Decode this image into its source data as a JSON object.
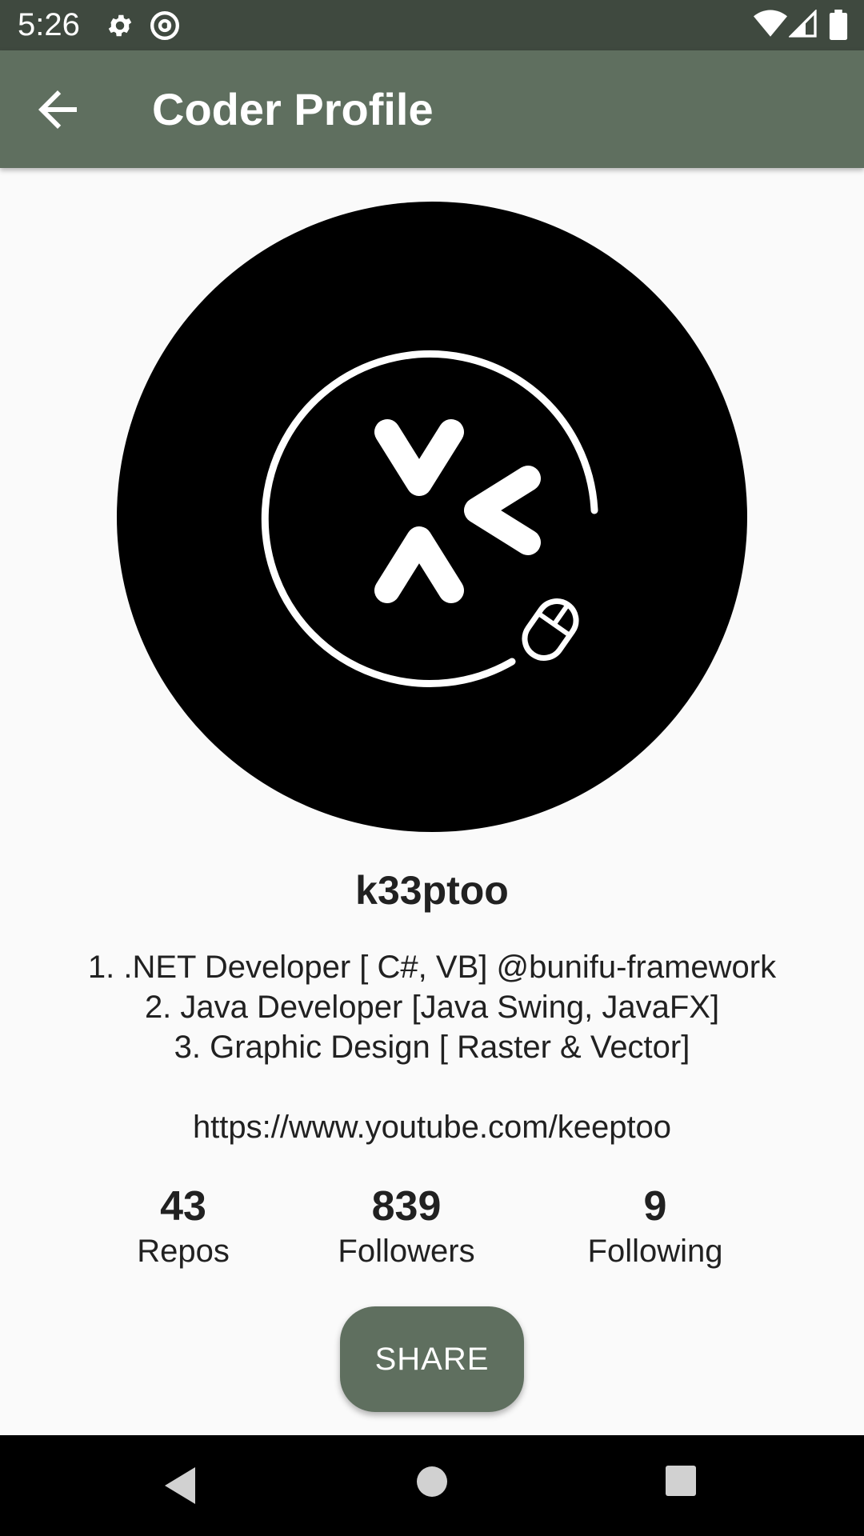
{
  "status_bar": {
    "time": "5:26",
    "icons": [
      "gear-icon",
      "at-sign-icon",
      "wifi-icon",
      "cell-signal-icon",
      "battery-icon"
    ]
  },
  "app_bar": {
    "title": "Coder Profile",
    "back_icon": "arrow-back-icon",
    "color": "#5f6f5f"
  },
  "profile": {
    "avatar_icon": "logo-avatar",
    "username": "k33ptoo",
    "bio_lines": [
      "1. .NET Developer [ C#, VB] @bunifu-framework",
      "2. Java Developer [Java Swing, JavaFX]",
      "3. Graphic Design [ Raster & Vector]"
    ],
    "link": "https://www.youtube.com/keeptoo"
  },
  "stats": [
    {
      "value": "43",
      "label": "Repos"
    },
    {
      "value": "839",
      "label": "Followers"
    },
    {
      "value": "9",
      "label": "Following"
    }
  ],
  "share_button": {
    "label": "SHARE",
    "color": "#5f6f5f"
  },
  "nav_bar": {
    "icons": [
      "back-triangle-icon",
      "home-circle-icon",
      "recents-square-icon"
    ]
  }
}
